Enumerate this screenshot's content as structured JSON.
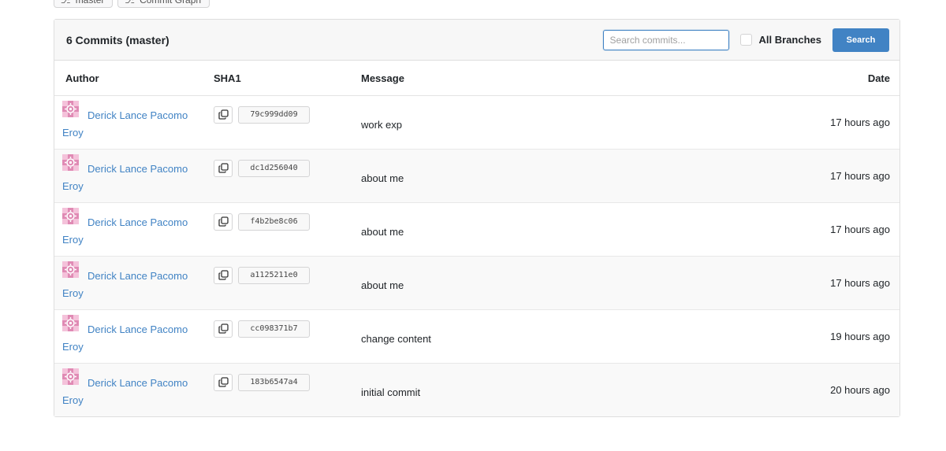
{
  "top_buttons": [
    {
      "label": "master",
      "icon": "branch-icon"
    },
    {
      "label": "Commit Graph",
      "icon": "branch-icon"
    }
  ],
  "header": {
    "title": "6 Commits (master)",
    "search_placeholder": "Search commits...",
    "all_branches_label": "All Branches",
    "search_button": "Search"
  },
  "columns": {
    "author": "Author",
    "sha": "SHA1",
    "message": "Message",
    "date": "Date"
  },
  "commits": [
    {
      "author": "Derick Lance Pacomo Eroy",
      "sha": "79c999dd09",
      "message": "work exp",
      "date": "17 hours ago"
    },
    {
      "author": "Derick Lance Pacomo Eroy",
      "sha": "dc1d256040",
      "message": "about me",
      "date": "17 hours ago"
    },
    {
      "author": "Derick Lance Pacomo Eroy",
      "sha": "f4b2be8c06",
      "message": "about me",
      "date": "17 hours ago"
    },
    {
      "author": "Derick Lance Pacomo Eroy",
      "sha": "a1125211e0",
      "message": "about me",
      "date": "17 hours ago"
    },
    {
      "author": "Derick Lance Pacomo Eroy",
      "sha": "cc098371b7",
      "message": "change content",
      "date": "19 hours ago"
    },
    {
      "author": "Derick Lance Pacomo Eroy",
      "sha": "183b6547a4",
      "message": "initial commit",
      "date": "20 hours ago"
    }
  ],
  "colors": {
    "accent": "#4183c4",
    "avatar": "#e08ab4"
  }
}
